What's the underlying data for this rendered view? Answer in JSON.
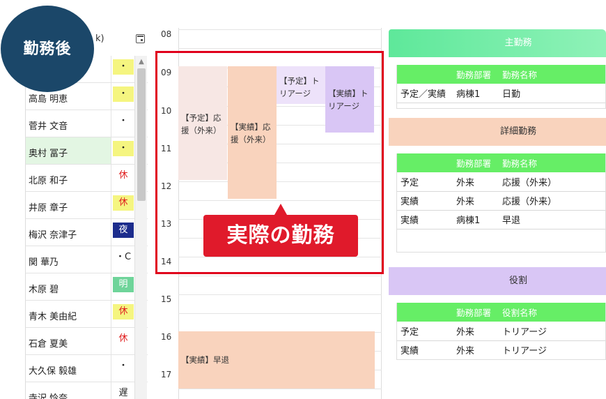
{
  "badge": "勤務後",
  "staff": {
    "header_fragment": "k)",
    "rows": [
      {
        "name": "",
        "mark": "・",
        "mark_bg": "#f5f580",
        "mark_color": "#222"
      },
      {
        "name": "高島 明恵",
        "mark": "・",
        "mark_bg": "#f5f580",
        "mark_color": "#222"
      },
      {
        "name": "菅井 文音",
        "mark": "・",
        "mark_bg": "#ffffff",
        "mark_color": "#222"
      },
      {
        "name": "奥村 冨子",
        "mark": "・",
        "mark_bg": "#f5f580",
        "mark_color": "#222"
      },
      {
        "name": "北原 和子",
        "mark": "休",
        "mark_bg": "#ffffff",
        "mark_color": "#e02020"
      },
      {
        "name": "井原 章子",
        "mark": "休",
        "mark_bg": "#f5f580",
        "mark_color": "#e02020"
      },
      {
        "name": "梅沢 奈津子",
        "mark": "夜",
        "mark_bg": "#1c2c8c",
        "mark_color": "#ffffff"
      },
      {
        "name": "関 華乃",
        "mark": "・C",
        "mark_bg": "#ffffff",
        "mark_color": "#222"
      },
      {
        "name": "木原 碧",
        "mark": "明",
        "mark_bg": "#6fd49a",
        "mark_color": "#ffffff"
      },
      {
        "name": "青木 美由紀",
        "mark": "休",
        "mark_bg": "#f5f580",
        "mark_color": "#e02020"
      },
      {
        "name": "石倉 夏美",
        "mark": "休",
        "mark_bg": "#ffffff",
        "mark_color": "#e02020"
      },
      {
        "name": "大久保 毅雄",
        "mark": "・",
        "mark_bg": "#ffffff",
        "mark_color": "#222"
      },
      {
        "name": "寺沢 怜奈",
        "mark": "遅",
        "mark_bg": "#ffffff",
        "mark_color": "#222"
      }
    ]
  },
  "timegrid": {
    "hours": [
      "08",
      "09",
      "10",
      "11",
      "12",
      "13",
      "14",
      "15",
      "16",
      "17"
    ],
    "events": [
      {
        "label": "【予定】応援（外来）",
        "bg": "#f7e7e4"
      },
      {
        "label": "【実績】応援（外来）",
        "bg": "#f9d3bd"
      },
      {
        "label": "【予定】トリアージ",
        "bg": "#ede2fa"
      },
      {
        "label": "【実績】トリアージ",
        "bg": "#d9c6f5"
      },
      {
        "label": "【実績】早退",
        "bg": "#f9d3bd"
      }
    ]
  },
  "callout": "実際の勤務",
  "panels": {
    "main": {
      "title": "主勤務",
      "color": "#5ee89a",
      "columns": [
        "",
        "勤務部署",
        "勤務名称"
      ],
      "rows": [
        [
          "予定／実績",
          "病棟1",
          "日勤"
        ]
      ]
    },
    "detail": {
      "title": "詳細勤務",
      "color": "#f9d3bd",
      "columns": [
        "",
        "勤務部署",
        "勤務名称"
      ],
      "rows": [
        [
          "予定",
          "外来",
          "応援（外来）"
        ],
        [
          "実績",
          "外来",
          "応援（外来）"
        ],
        [
          "実績",
          "病棟1",
          "早退"
        ]
      ]
    },
    "role": {
      "title": "役割",
      "color": "#d9c6f5",
      "columns": [
        "",
        "勤務部署",
        "役割名称"
      ],
      "rows": [
        [
          "予定",
          "外来",
          "トリアージ"
        ],
        [
          "実績",
          "外来",
          "トリアージ"
        ]
      ]
    }
  }
}
